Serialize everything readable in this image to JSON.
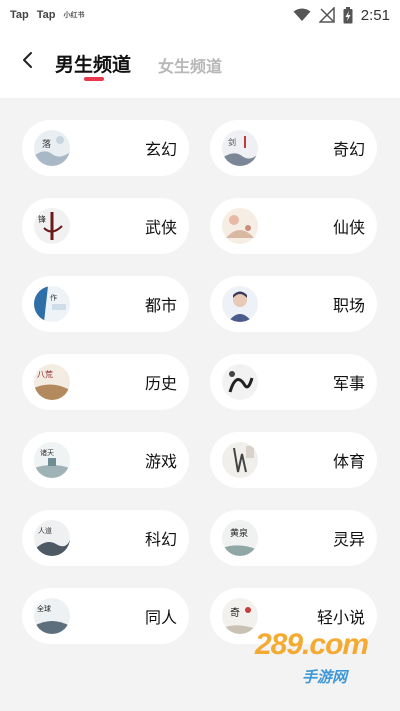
{
  "status_bar": {
    "apps": [
      "Tap",
      "Tap"
    ],
    "app_small": "小红书",
    "time": "2:51",
    "icons": [
      "wifi-icon",
      "no-signal-icon",
      "battery-charging-icon"
    ]
  },
  "header": {
    "tabs": [
      {
        "label": "男生频道",
        "active": true
      },
      {
        "label": "女生频道",
        "active": false
      }
    ],
    "accent_color": "#e8384a"
  },
  "categories": [
    {
      "label": "玄幻",
      "cover": "cover-xuanhuan"
    },
    {
      "label": "奇幻",
      "cover": "cover-qihuan"
    },
    {
      "label": "武侠",
      "cover": "cover-wuxia"
    },
    {
      "label": "仙侠",
      "cover": "cover-xianxia"
    },
    {
      "label": "都市",
      "cover": "cover-dushi"
    },
    {
      "label": "职场",
      "cover": "cover-zhichang"
    },
    {
      "label": "历史",
      "cover": "cover-lishi"
    },
    {
      "label": "军事",
      "cover": "cover-junshi"
    },
    {
      "label": "游戏",
      "cover": "cover-youxi"
    },
    {
      "label": "体育",
      "cover": "cover-tiyu"
    },
    {
      "label": "科幻",
      "cover": "cover-kehuan"
    },
    {
      "label": "灵异",
      "cover": "cover-lingyi"
    },
    {
      "label": "同人",
      "cover": "cover-tongren"
    },
    {
      "label": "轻小说",
      "cover": "cover-qingxiaoshuo"
    }
  ],
  "watermark": {
    "domain": "289.com",
    "sub": "手游网"
  }
}
